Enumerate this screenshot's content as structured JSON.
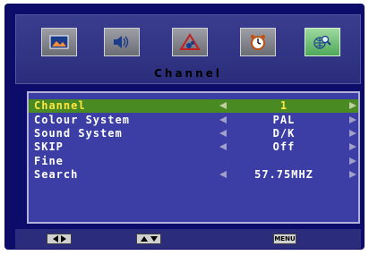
{
  "menu": {
    "title": "Channel",
    "top_icons": [
      {
        "name": "picture-icon",
        "active": false
      },
      {
        "name": "sound-icon",
        "active": false
      },
      {
        "name": "setup-icon",
        "active": false
      },
      {
        "name": "timer-icon",
        "active": false
      },
      {
        "name": "channel-search-icon",
        "active": true
      }
    ],
    "rows": [
      {
        "label": "Channel",
        "value": "1",
        "arrows": true,
        "selected": true
      },
      {
        "label": "Colour System",
        "value": "PAL",
        "arrows": true,
        "selected": false
      },
      {
        "label": "Sound System",
        "value": "D/K",
        "arrows": true,
        "selected": false
      },
      {
        "label": "SKIP",
        "value": "Off",
        "arrows": true,
        "selected": false
      },
      {
        "label": "Fine",
        "value": "",
        "arrows": "right",
        "selected": false
      },
      {
        "label": "Search",
        "value": "57.75MHZ",
        "arrows": true,
        "selected": false
      }
    ]
  },
  "footer": {
    "lr_hint": "left-right-keys-icon",
    "ud_hint": "up-down-keys-icon",
    "menu_key": "MENU"
  },
  "colors": {
    "background": "#0c0c6a",
    "panel": "#3c3ea6",
    "selected_row": "#4a8a22",
    "selected_text": "#ffe640",
    "text": "#ffffff"
  }
}
